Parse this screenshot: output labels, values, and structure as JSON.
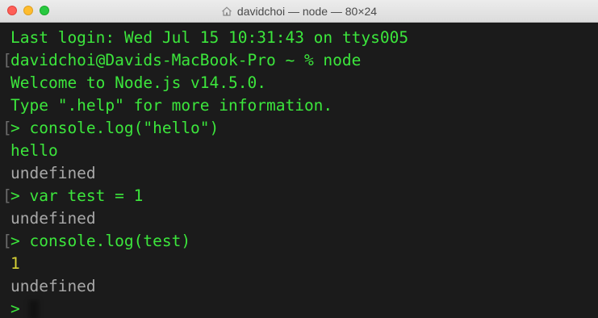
{
  "window": {
    "title": "davidchoi — node — 80×24",
    "colors": {
      "background": "#1b1b1b",
      "prompt_green": "#3ce63c",
      "output_gray": "#a8a8a8",
      "number_yellow": "#d8d235"
    }
  },
  "terminal": {
    "lines": [
      {
        "text": "Last login: Wed Jul 15 10:31:43 on ttys005",
        "color": "green",
        "bracket": false
      },
      {
        "text": "davidchoi@Davids-MacBook-Pro ~ % node",
        "color": "green",
        "bracket": true
      },
      {
        "text": "Welcome to Node.js v14.5.0.",
        "color": "green",
        "bracket": false
      },
      {
        "text": "Type \".help\" for more information.",
        "color": "green",
        "bracket": false
      },
      {
        "text": "> console.log(\"hello\")",
        "color": "green",
        "bracket": true
      },
      {
        "text": "hello",
        "color": "green",
        "bracket": false
      },
      {
        "text": "undefined",
        "color": "gray",
        "bracket": false
      },
      {
        "text": "> var test = 1",
        "color": "green",
        "bracket": true
      },
      {
        "text": "undefined",
        "color": "gray",
        "bracket": false
      },
      {
        "text": "> console.log(test)",
        "color": "green",
        "bracket": true
      },
      {
        "text": "1",
        "color": "yellow",
        "bracket": false
      },
      {
        "text": "undefined",
        "color": "gray",
        "bracket": false
      },
      {
        "text": "> ",
        "color": "green",
        "bracket": false
      }
    ]
  }
}
